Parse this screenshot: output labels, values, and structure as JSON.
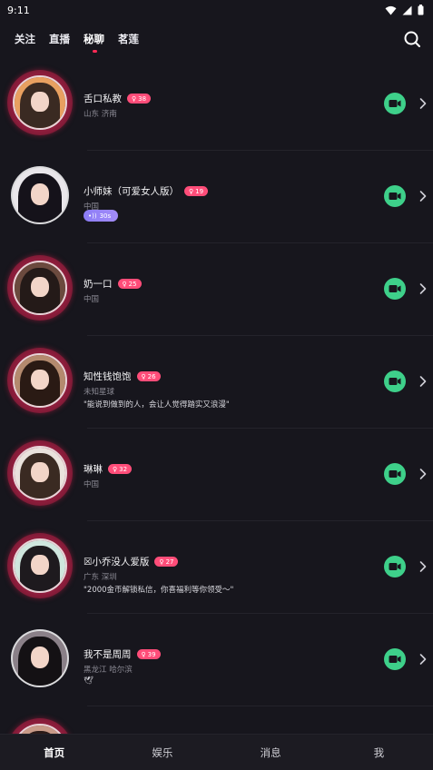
{
  "status": {
    "time": "9:11"
  },
  "topnav": {
    "tabs": [
      {
        "label": "关注",
        "active": false
      },
      {
        "label": "直播",
        "active": false
      },
      {
        "label": "秘聊",
        "active": true
      },
      {
        "label": "茗莲",
        "active": false
      }
    ]
  },
  "users": [
    {
      "name": "舌口私教",
      "age": "38",
      "location": "山东 济南",
      "quote": "",
      "ring": true,
      "tone": "#e8a060",
      "hair": "#3a2a22"
    },
    {
      "name": "小师妹（可爱女人版）",
      "age": "19",
      "location": "中国",
      "quote": "",
      "voice": "30s",
      "ring": false,
      "tone": "#e9e6ea",
      "hair": "#15121a"
    },
    {
      "name": "奶一口",
      "age": "25",
      "location": "中国",
      "quote": "",
      "ring": true,
      "tone": "#6b4a3e",
      "hair": "#241a18"
    },
    {
      "name": "知性钱饱饱",
      "age": "26",
      "location": "未知星球",
      "quote": "\"能说到做到的人，会让人觉得踏实又浪漫\"",
      "ring": true,
      "tone": "#b48a6e",
      "hair": "#2a1a14"
    },
    {
      "name": "琳琳",
      "age": "32",
      "location": "中国",
      "quote": "",
      "ring": true,
      "tone": "#e9e2dc",
      "hair": "#3a2a22"
    },
    {
      "name": "☒小乔没人爱版",
      "age": "27",
      "location": "广东 深圳",
      "quote": "\"2000金币解锁私信，你喜福利等你领受～\"",
      "ring": true,
      "tone": "#cfe6de",
      "hair": "#1e1a1e"
    },
    {
      "name": "我不是周周",
      "age": "39",
      "location": "黑龙江 哈尔滨",
      "quote": "🕊",
      "ring": false,
      "tone": "#8a8088",
      "hair": "#141114"
    },
    {
      "name": "",
      "age": "",
      "location": "",
      "quote": "",
      "ring": true,
      "tone": "#c89a88",
      "hair": "#2a1a18"
    }
  ],
  "bottom_nav": [
    {
      "label": "首页",
      "active": true
    },
    {
      "label": "娱乐",
      "active": false
    },
    {
      "label": "消息",
      "active": false
    },
    {
      "label": "我",
      "active": false
    }
  ],
  "colors": {
    "accent": "#ff2a55",
    "video": "#3ed08a",
    "badge": "#ff4d79",
    "voice": "#8b7cf6"
  }
}
